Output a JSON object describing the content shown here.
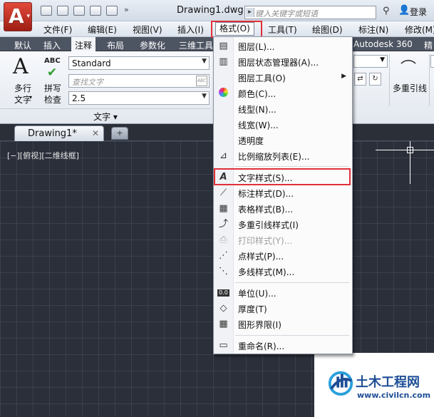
{
  "title_bar": {
    "app_button_logo": "A",
    "document_title": "Drawing1.dwg",
    "search_placeholder": "键入关键字或短语",
    "login_label": "登录",
    "quick_access_icons": [
      "new-file-icon",
      "open-folder-icon",
      "save-icon",
      "save-as-icon",
      "print-icon"
    ]
  },
  "menubar": {
    "items": [
      "文件(F)",
      "编辑(E)",
      "视图(V)",
      "插入(I)",
      "格式(O)",
      "工具(T)",
      "绘图(D)",
      "标注(N)",
      "修改(M)"
    ],
    "active": "格式(O)"
  },
  "ribbon_tabs": {
    "items": [
      "默认",
      "插入",
      "注释",
      "布局",
      "参数化",
      "三维工具",
      "Autodesk 360",
      "精"
    ],
    "active": "注释"
  },
  "ribbon": {
    "mtext_label_1": "多行",
    "mtext_label_2": "文字",
    "spell_abc": "ABC",
    "spell_label_1": "拼写",
    "spell_label_2": "检查",
    "text_style_value": "Standard",
    "find_text_placeholder": "查找文字",
    "text_height_value": "2.5",
    "panel_title": "文字 ▾",
    "leader_label": "多重引线"
  },
  "doc_tabs": {
    "active_tab": "Drawing1*",
    "close_glyph": "✕"
  },
  "viewport": {
    "label": "[−][俯视][二维线框]"
  },
  "format_menu": {
    "items": [
      {
        "label": "图层(L)...",
        "icon": "layer-icon",
        "enabled": true,
        "submenu": false
      },
      {
        "label": "图层状态管理器(A)...",
        "icon": "layer-state-icon",
        "enabled": true,
        "submenu": false
      },
      {
        "label": "图层工具(O)",
        "icon": "",
        "enabled": true,
        "submenu": true
      },
      {
        "label": "颜色(C)...",
        "icon": "color-wheel-icon",
        "enabled": true,
        "submenu": false
      },
      {
        "label": "线型(N)...",
        "icon": "",
        "enabled": true,
        "submenu": false
      },
      {
        "label": "线宽(W)...",
        "icon": "",
        "enabled": true,
        "submenu": false
      },
      {
        "label": "透明度",
        "icon": "",
        "enabled": true,
        "submenu": false
      },
      {
        "label": "比例缩放列表(E)...",
        "icon": "scale-list-icon",
        "enabled": true,
        "submenu": false
      },
      {
        "label": "文字样式(S)...",
        "icon": "text-style-icon",
        "enabled": true,
        "submenu": false
      },
      {
        "label": "标注样式(D)...",
        "icon": "dimension-style-icon",
        "enabled": true,
        "submenu": false
      },
      {
        "label": "表格样式(B)...",
        "icon": "table-style-icon",
        "enabled": true,
        "submenu": false
      },
      {
        "label": "多重引线样式(I)",
        "icon": "multileader-style-icon",
        "enabled": true,
        "submenu": false
      },
      {
        "label": "打印样式(Y)...",
        "icon": "plot-style-icon",
        "enabled": false,
        "submenu": false
      },
      {
        "label": "点样式(P)...",
        "icon": "point-style-icon",
        "enabled": true,
        "submenu": false
      },
      {
        "label": "多线样式(M)...",
        "icon": "multiline-style-icon",
        "enabled": true,
        "submenu": false
      },
      {
        "label": "单位(U)...",
        "icon": "units-icon",
        "enabled": true,
        "submenu": false
      },
      {
        "label": "厚度(T)",
        "icon": "thickness-icon",
        "enabled": true,
        "submenu": false
      },
      {
        "label": "图形界限(I)",
        "icon": "drawing-limits-icon",
        "enabled": true,
        "submenu": false
      },
      {
        "label": "重命名(R)...",
        "icon": "rename-icon",
        "enabled": true,
        "submenu": false
      }
    ],
    "highlighted": "文字样式(S)..."
  },
  "watermark": {
    "title": "土木工程网",
    "url": "www.civilcn.com"
  },
  "colors": {
    "app_red": "#c0301f",
    "highlight_border": "#e0303a",
    "canvas_bg": "#2b2f3a",
    "ribbon_tab_bg": "#4d5462",
    "watermark_blue": "#1e4e96"
  }
}
